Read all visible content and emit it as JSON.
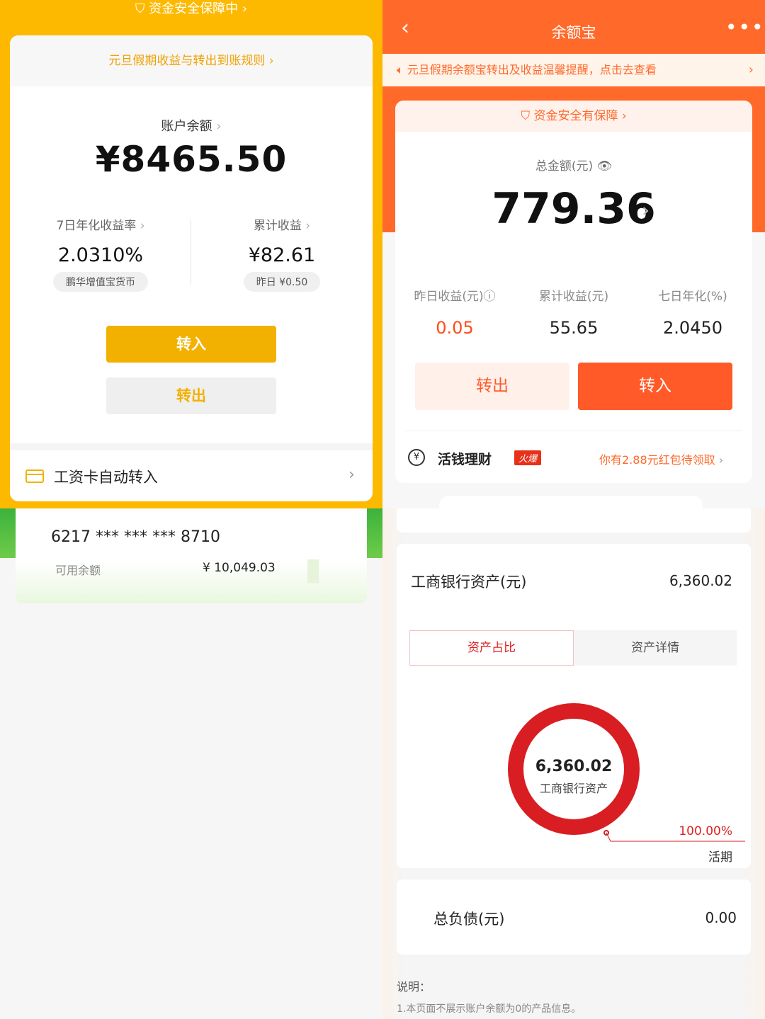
{
  "left_top": {
    "safety_banner": "资金安全保障中",
    "notice": "元旦假期收益与转出到账规则",
    "balance_label": "账户余额",
    "balance_value": "¥8465.50",
    "yield_label": "7日年化收益率",
    "yield_value": "2.0310%",
    "fund_name": "鹏华增值宝货币",
    "cumulative_label": "累计收益",
    "cumulative_value": "¥82.61",
    "yesterday_pill": "昨日 ¥0.50",
    "transfer_in": "转入",
    "transfer_out": "转出",
    "auto_transfer": "工资卡自动转入",
    "accent_color": "#fdb900"
  },
  "right_top": {
    "title": "余额宝",
    "notice": "元旦假期余额宝转出及收益温馨提醒，点击去查看",
    "safety_band": "资金安全有保障",
    "total_label": "总金额(元)",
    "total_value": "779.36",
    "stats": [
      {
        "label": "昨日收益(元)",
        "value": "0.05"
      },
      {
        "label": "累计收益(元)",
        "value": "55.65"
      },
      {
        "label": "七日年化(%)",
        "value": "2.0450"
      }
    ],
    "transfer_out": "转出",
    "transfer_in": "转入",
    "live_label": "活钱理财",
    "hot_badge": "火爆",
    "red_packet": "你有2.88元红包待领取",
    "accent_color": "#ff6a2b"
  },
  "left_bottom": {
    "card_number": "6217 *** *** *** 8710",
    "available_label": "可用余额",
    "available_value": "¥ 10,049.03"
  },
  "right_bottom": {
    "asset_label": "工商银行资产(元)",
    "asset_value": "6,360.02",
    "tabs": [
      "资产占比",
      "资产详情"
    ],
    "donut_value": "6,360.02",
    "donut_label": "工商银行资产",
    "percent": "100.00%",
    "category": "活期",
    "ring_fraction": 1.0,
    "ring_color": "#d81e23",
    "debt_label": "总负债(元)",
    "debt_value": "0.00",
    "note_title": "说明：",
    "note_1": "1.本页面不展示账户余额为0的产品信息。"
  }
}
